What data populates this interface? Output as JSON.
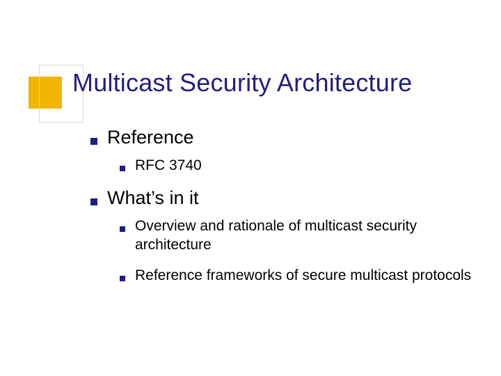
{
  "title": "Multicast Security Architecture",
  "sections": [
    {
      "label": "Reference",
      "items": [
        "RFC 3740"
      ]
    },
    {
      "label": "What’s in it",
      "items": [
        "Overview and rationale of multicast security architecture",
        "Reference frameworks of secure multicast protocols"
      ]
    }
  ]
}
